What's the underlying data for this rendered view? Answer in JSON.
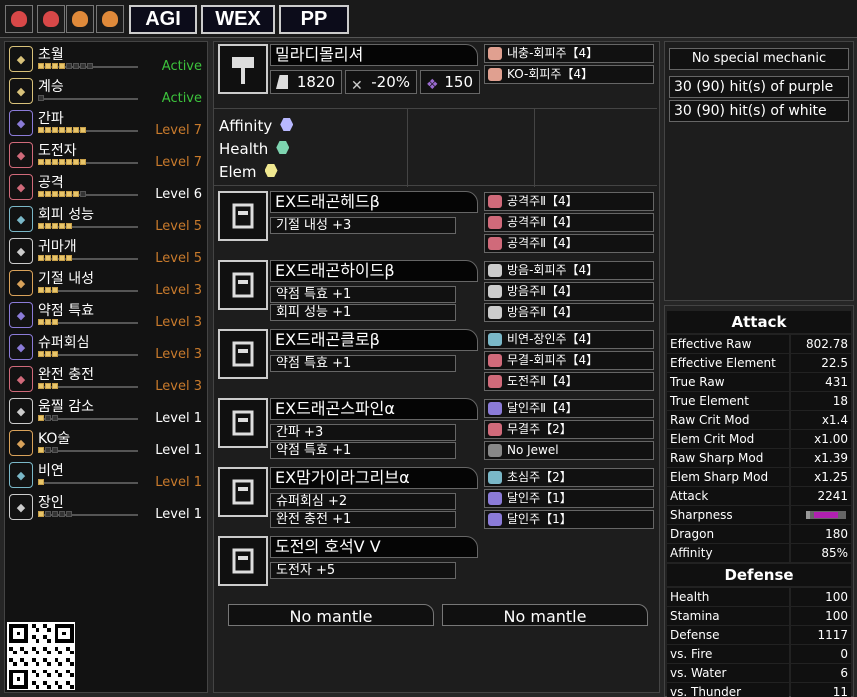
{
  "toolbar": {
    "buttons": [
      "AGI",
      "WEX",
      "PP"
    ],
    "icons": [
      "slot-icon-1",
      "slot-icon-2",
      "slot-icon-3",
      "slot-icon-4"
    ]
  },
  "skills": [
    {
      "name": "초월",
      "filled": 4,
      "total": 8,
      "level": "Active",
      "level_color": "#3cc23c",
      "icon_color": "#d9c27a"
    },
    {
      "name": "계승",
      "filled": 0,
      "total": 1,
      "level": "Active",
      "level_color": "#3cc23c",
      "icon_color": "#d9c27a"
    },
    {
      "name": "간파",
      "filled": 7,
      "total": 7,
      "level": "Level 7",
      "level_color": "#c87a2c",
      "icon_color": "#8b7bd8"
    },
    {
      "name": "도전자",
      "filled": 7,
      "total": 7,
      "level": "Level 7",
      "level_color": "#c87a2c",
      "icon_color": "#d06a7a"
    },
    {
      "name": "공격",
      "filled": 6,
      "total": 7,
      "level": "Level 6",
      "level_color": "#ffffff",
      "icon_color": "#d06a7a"
    },
    {
      "name": "회피 성능",
      "filled": 5,
      "total": 5,
      "level": "Level 5",
      "level_color": "#c87a2c",
      "icon_color": "#7ab8c8"
    },
    {
      "name": "귀마개",
      "filled": 5,
      "total": 5,
      "level": "Level 5",
      "level_color": "#c87a2c",
      "icon_color": "#cccccc"
    },
    {
      "name": "기절 내성",
      "filled": 3,
      "total": 3,
      "level": "Level 3",
      "level_color": "#c87a2c",
      "icon_color": "#d9a25a"
    },
    {
      "name": "약점 특효",
      "filled": 3,
      "total": 3,
      "level": "Level 3",
      "level_color": "#c87a2c",
      "icon_color": "#8b7bd8"
    },
    {
      "name": "슈퍼회심",
      "filled": 3,
      "total": 3,
      "level": "Level 3",
      "level_color": "#c87a2c",
      "icon_color": "#8b7bd8"
    },
    {
      "name": "완전 충전",
      "filled": 3,
      "total": 3,
      "level": "Level 3",
      "level_color": "#c87a2c",
      "icon_color": "#d06a7a"
    },
    {
      "name": "움찔 감소",
      "filled": 1,
      "total": 3,
      "level": "Level 1",
      "level_color": "#ffffff",
      "icon_color": "#cccccc"
    },
    {
      "name": "KO술",
      "filled": 1,
      "total": 3,
      "level": "Level 1",
      "level_color": "#ffffff",
      "icon_color": "#d9a25a"
    },
    {
      "name": "비연",
      "filled": 1,
      "total": 1,
      "level": "Level 1",
      "level_color": "#c87a2c",
      "icon_color": "#7ab8c8"
    },
    {
      "name": "장인",
      "filled": 1,
      "total": 5,
      "level": "Level 1",
      "level_color": "#ffffff",
      "icon_color": "#cccccc"
    }
  ],
  "weapon": {
    "name": "밀라디몰리셔",
    "attack": "1820",
    "affinity": "-20%",
    "element": "150",
    "jewels": [
      {
        "name": "내충-회피주【4】",
        "color": "#e0a090"
      },
      {
        "name": "KO-회피주【4】",
        "color": "#e0a090"
      }
    ],
    "mods": [
      {
        "label": "Affinity",
        "icon_color": "#b8b8ff"
      },
      {
        "label": "Health",
        "icon_color": "#7ed4b0"
      },
      {
        "label": "Elem",
        "icon_color": "#f0e890"
      }
    ]
  },
  "armor": [
    {
      "name": "EX드래곤헤드β",
      "skills": [
        "기절 내성 +3"
      ],
      "jewels": [
        {
          "name": "공격주Ⅱ【4】",
          "color": "#d06a7a"
        },
        {
          "name": "공격주Ⅱ【4】",
          "color": "#d06a7a"
        },
        {
          "name": "공격주Ⅱ【4】",
          "color": "#d06a7a"
        }
      ]
    },
    {
      "name": "EX드래곤하이드β",
      "skills": [
        "약점 특효 +1",
        "회피 성능 +1"
      ],
      "jewels": [
        {
          "name": "방음-회피주【4】",
          "color": "#cccccc"
        },
        {
          "name": "방음주Ⅱ【4】",
          "color": "#cccccc"
        },
        {
          "name": "방음주Ⅱ【4】",
          "color": "#cccccc"
        }
      ]
    },
    {
      "name": "EX드래곤클로β",
      "skills": [
        "약점 특효 +1"
      ],
      "jewels": [
        {
          "name": "비연-장인주【4】",
          "color": "#7ab8c8"
        },
        {
          "name": "무결-회피주【4】",
          "color": "#d06a7a"
        },
        {
          "name": "도전주Ⅱ【4】",
          "color": "#d06a7a"
        }
      ]
    },
    {
      "name": "EX드래곤스파인α",
      "skills": [
        "간파 +3",
        "약점 특효 +1"
      ],
      "jewels": [
        {
          "name": "달인주Ⅱ【4】",
          "color": "#8b7bd8"
        },
        {
          "name": "무결주【2】",
          "color": "#d06a7a"
        },
        {
          "name": "No Jewel",
          "color": "#888888"
        }
      ]
    },
    {
      "name": "EX맘가이라그리브α",
      "skills": [
        "슈퍼회심 +2",
        "완전 충전 +1"
      ],
      "jewels": [
        {
          "name": "초심주【2】",
          "color": "#7ab8c8"
        },
        {
          "name": "달인주【1】",
          "color": "#8b7bd8"
        },
        {
          "name": "달인주【1】",
          "color": "#8b7bd8"
        }
      ]
    },
    {
      "name": "도전의 호석Ⅴ Ⅴ",
      "skills": [
        "도전자 +5"
      ],
      "jewels": []
    }
  ],
  "mantles": [
    "No mantle",
    "No mantle"
  ],
  "mechanic": {
    "title": "No special mechanic",
    "lines": [
      "30 (90) hit(s) of purple",
      "30 (90) hit(s) of white"
    ]
  },
  "attack_stats": {
    "heading": "Attack",
    "rows": [
      {
        "k": "Effective Raw",
        "v": "802.78"
      },
      {
        "k": "Effective Element",
        "v": "22.5"
      },
      {
        "k": "True Raw",
        "v": "431"
      },
      {
        "k": "True Element",
        "v": "18"
      },
      {
        "k": "Raw Crit Mod",
        "v": "x1.4"
      },
      {
        "k": "Elem Crit Mod",
        "v": "x1.00"
      },
      {
        "k": "Raw Sharp Mod",
        "v": "x1.39"
      },
      {
        "k": "Elem Sharp Mod",
        "v": "x1.25"
      },
      {
        "k": "Attack",
        "v": "2241"
      },
      {
        "k": "Sharpness",
        "v": ""
      },
      {
        "k": "Dragon",
        "v": "180"
      },
      {
        "k": "Affinity",
        "v": "85%"
      }
    ],
    "sharpness_color": "#b020b0"
  },
  "defense_stats": {
    "heading": "Defense",
    "rows": [
      {
        "k": "Health",
        "v": "100"
      },
      {
        "k": "Stamina",
        "v": "100"
      },
      {
        "k": "Defense",
        "v": "1117"
      },
      {
        "k": "vs. Fire",
        "v": "0"
      },
      {
        "k": "vs. Water",
        "v": "6"
      },
      {
        "k": "vs. Thunder",
        "v": "11"
      }
    ]
  }
}
